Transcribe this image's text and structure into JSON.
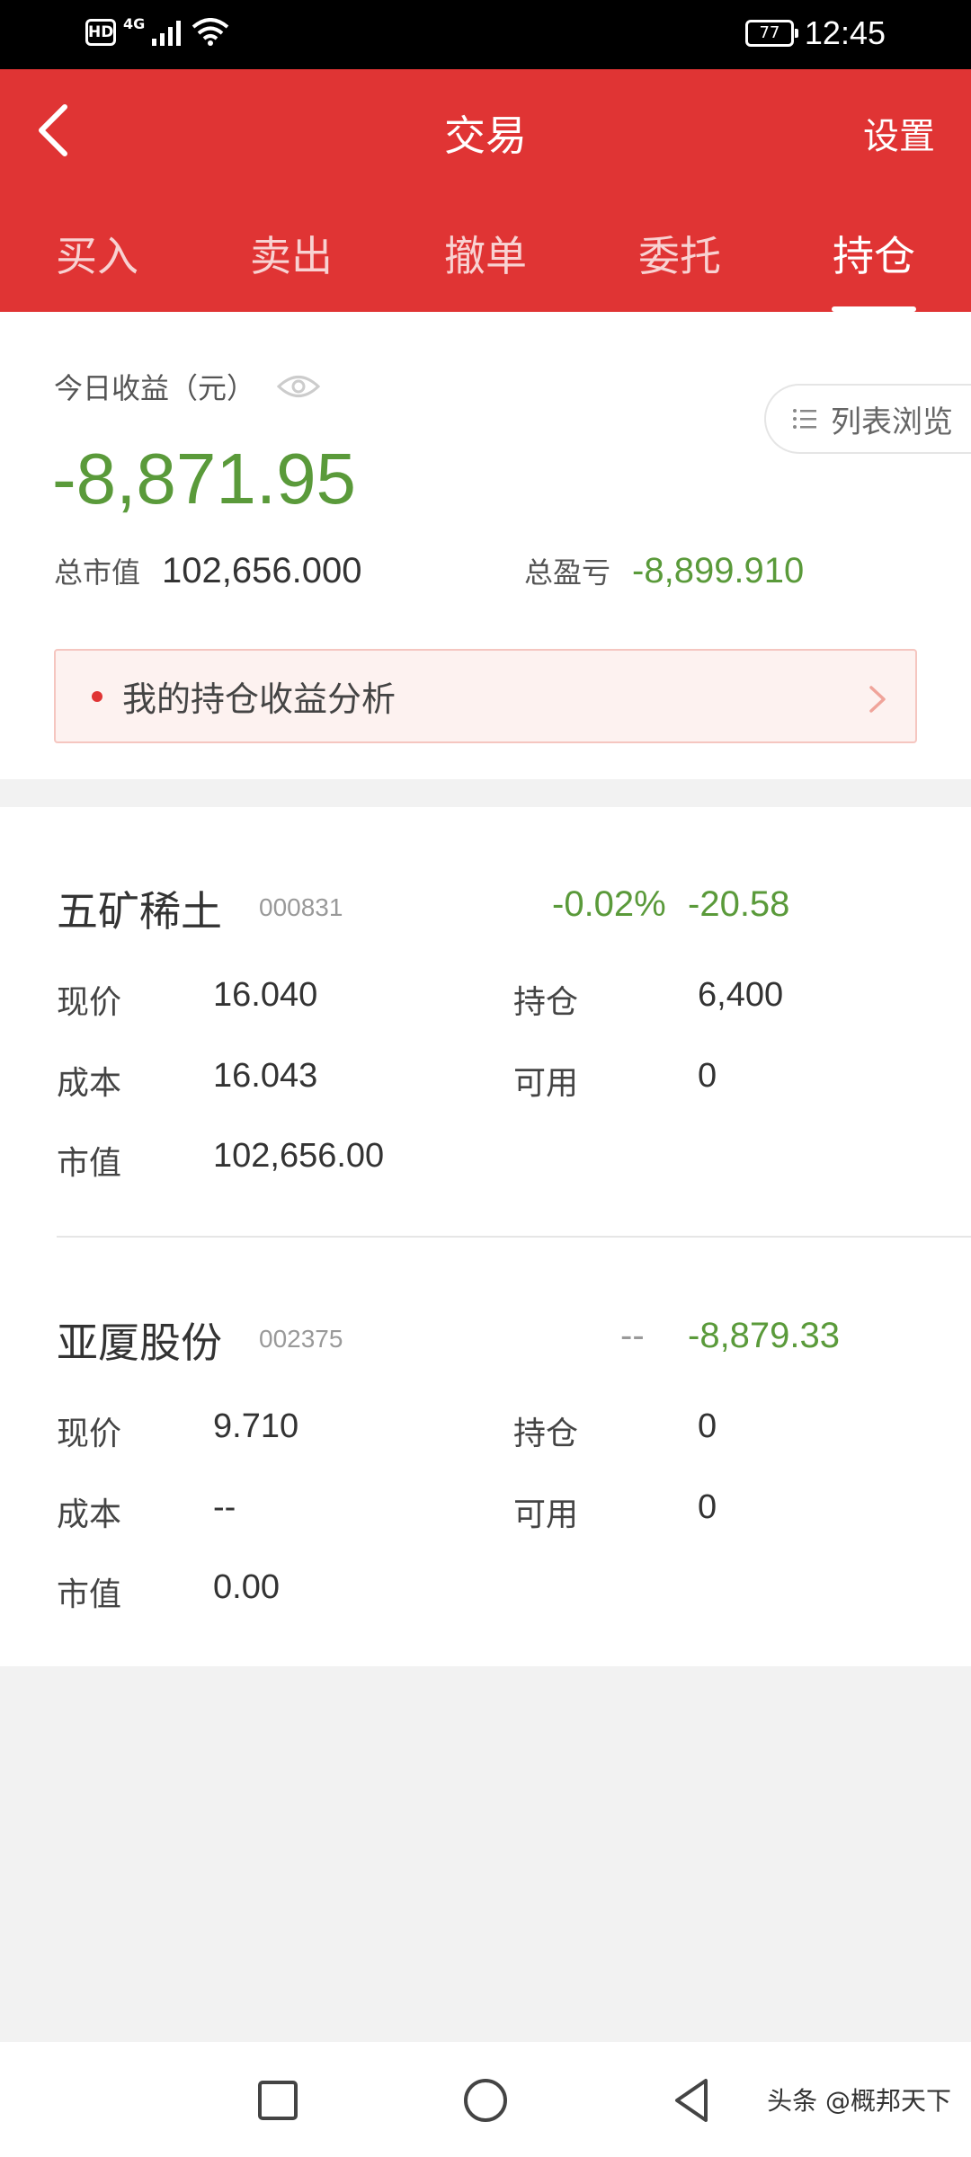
{
  "status_bar": {
    "hd": "HD",
    "network": "4G",
    "battery": "77",
    "time": "12:45"
  },
  "header": {
    "title": "交易",
    "settings_label": "设置",
    "tabs": [
      {
        "label": "买入",
        "active": false
      },
      {
        "label": "卖出",
        "active": false
      },
      {
        "label": "撤单",
        "active": false
      },
      {
        "label": "委托",
        "active": false
      },
      {
        "label": "持仓",
        "active": true
      }
    ]
  },
  "summary": {
    "today_label": "今日收益（元）",
    "today_value": "-8,871.95",
    "list_view_label": "列表浏览",
    "market_value_label": "总市值",
    "market_value": "102,656.000",
    "total_pnl_label": "总盈亏",
    "total_pnl": "-8,899.910",
    "analysis_label": "我的持仓收益分析"
  },
  "positions": [
    {
      "name": "五矿稀土",
      "code": "000831",
      "change_pct": "-0.02%",
      "pnl": "-20.58",
      "price_label": "现价",
      "price": "16.040",
      "holding_label": "持仓",
      "holding": "6,400",
      "cost_label": "成本",
      "cost": "16.043",
      "available_label": "可用",
      "available": "0",
      "market_value_label": "市值",
      "market_value": "102,656.00"
    },
    {
      "name": "亚厦股份",
      "code": "002375",
      "change_pct": "--",
      "pnl": "-8,879.33",
      "price_label": "现价",
      "price": "9.710",
      "holding_label": "持仓",
      "holding": "0",
      "cost_label": "成本",
      "cost": "--",
      "available_label": "可用",
      "available": "0",
      "market_value_label": "市值",
      "market_value": "0.00"
    }
  ],
  "watermark": "头条 @概邦天下",
  "colors": {
    "brand_red": "#e03434",
    "loss_green": "#5a9a3a",
    "muted_gray": "#999999"
  }
}
